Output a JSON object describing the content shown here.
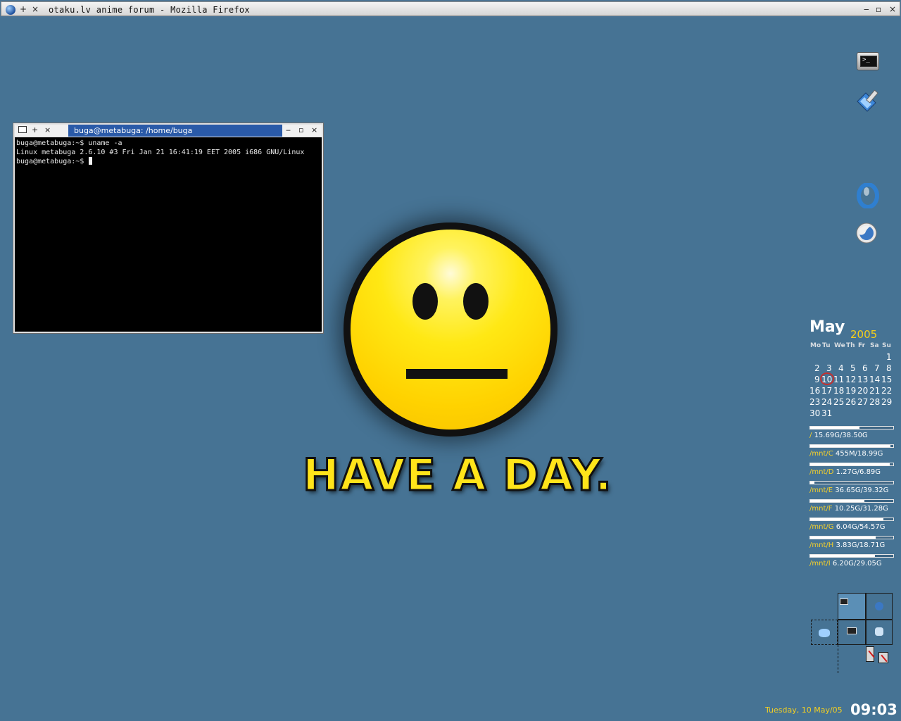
{
  "firefox_window": {
    "title": "otaku.lv anime forum - Mozilla Firefox",
    "btn_add": "+",
    "btn_close": "×",
    "btn_minimize": "‒",
    "btn_maximize": "▫",
    "btn_close_right": "×"
  },
  "terminal": {
    "title": "buga@metabuga: /home/buga",
    "btn_add": "+",
    "btn_close": "×",
    "btn_minimize": "‒",
    "btn_maximize": "▫",
    "btn_close_right": "×",
    "lines": [
      "buga@metabuga:~$ uname -a",
      "Linux metabuga 2.6.10 #3 Fri Jan 21 16:41:19 EET 2005 i686 GNU/Linux",
      "buga@metabuga:~$ "
    ]
  },
  "wallpaper": {
    "slogan": "HAVE A DAY."
  },
  "dock": {
    "icons": [
      "terminal-icon",
      "settings-brush-icon",
      "opera-icon",
      "firefox-icon"
    ]
  },
  "calendar": {
    "month": "May",
    "year": "2005",
    "weekdays": [
      "Mo",
      "Tu",
      "We",
      "Th",
      "Fr",
      "Sa",
      "Su"
    ],
    "weeks": [
      [
        "",
        "",
        "",
        "",
        "",
        "",
        "1"
      ],
      [
        "2",
        "3",
        "4",
        "5",
        "6",
        "7",
        "8"
      ],
      [
        "9",
        "10",
        "11",
        "12",
        "13",
        "14",
        "15"
      ],
      [
        "16",
        "17",
        "18",
        "19",
        "20",
        "21",
        "22"
      ],
      [
        "23",
        "24",
        "25",
        "26",
        "27",
        "28",
        "29"
      ],
      [
        "30",
        "31",
        "",
        "",
        "",
        "",
        ""
      ]
    ],
    "today": "10"
  },
  "disks": [
    {
      "mount": "/",
      "usage": "15.69G/38.50G",
      "fraction": 0.59
    },
    {
      "mount": "/mnt/C",
      "usage": "455M/18.99G",
      "fraction": 0.97
    },
    {
      "mount": "/mnt/D",
      "usage": "1.27G/6.89G",
      "fraction": 0.96
    },
    {
      "mount": "/mnt/E",
      "usage": "36.65G/39.32G",
      "fraction": 0.05
    },
    {
      "mount": "/mnt/F",
      "usage": "10.25G/31.28G",
      "fraction": 0.65
    },
    {
      "mount": "/mnt/G",
      "usage": "6.04G/54.57G",
      "fraction": 0.88
    },
    {
      "mount": "/mnt/H",
      "usage": "3.83G/18.71G",
      "fraction": 0.79
    },
    {
      "mount": "/mnt/I",
      "usage": "6.20G/29.05G",
      "fraction": 0.78
    }
  ],
  "clock": {
    "date": "Tuesday, 10 May/05",
    "time": "09:03"
  },
  "colors": {
    "desktop_bg": "#467394",
    "accent_yellow": "#f3cf22",
    "terminal_titlebar": "#2a5aa8"
  }
}
